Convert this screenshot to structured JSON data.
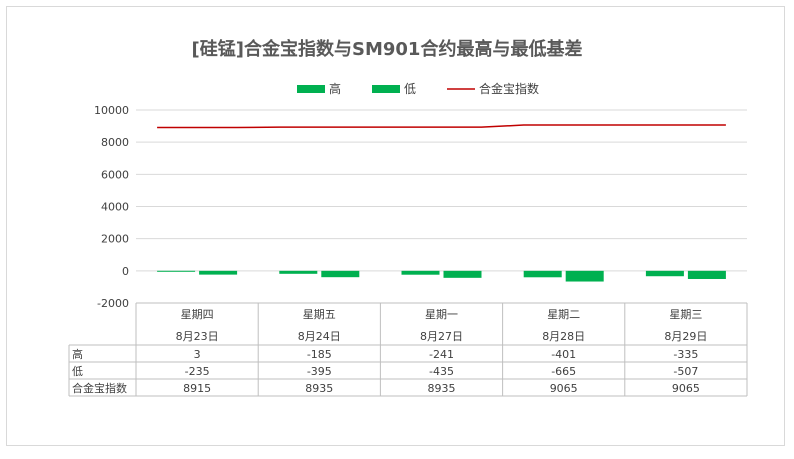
{
  "chart_data": {
    "type": "bar",
    "title": "[硅锰]合金宝指数与SM901合约最高与最低基差",
    "categories": [
      [
        "星期四",
        "8月23日"
      ],
      [
        "星期五",
        "8月24日"
      ],
      [
        "星期一",
        "8月27日"
      ],
      [
        "星期二",
        "8月28日"
      ],
      [
        "星期三",
        "8月29日"
      ]
    ],
    "series": [
      {
        "name": "高",
        "type": "bar",
        "color": "#00b050",
        "values": [
          3,
          -185,
          -241,
          -401,
          -335
        ]
      },
      {
        "name": "低",
        "type": "bar",
        "color": "#00b050",
        "values": [
          -235,
          -395,
          -435,
          -665,
          -507
        ]
      },
      {
        "name": "合金宝指数",
        "type": "line",
        "color": "#c00000",
        "values": [
          8915,
          8935,
          8935,
          9065,
          9065
        ]
      }
    ],
    "yticks": [
      10000,
      8000,
      6000,
      4000,
      2000,
      0,
      -2000
    ],
    "ylim": [
      -2000,
      10000
    ],
    "grid": true,
    "legend_position": "top",
    "data_table": true
  }
}
